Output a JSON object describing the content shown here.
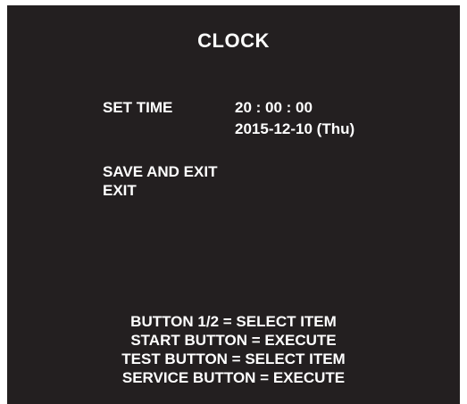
{
  "screen": {
    "title": "CLOCK",
    "set_time": {
      "label": "SET TIME",
      "time": "20 : 00 : 00",
      "date": "2015-12-10 (Thu)"
    },
    "menu": {
      "save_and_exit": "SAVE AND EXIT",
      "exit": "EXIT"
    },
    "help": [
      "BUTTON 1/2 = SELECT ITEM",
      "START BUTTON = EXECUTE",
      "TEST BUTTON = SELECT ITEM",
      "SERVICE BUTTON = EXECUTE"
    ]
  },
  "colors": {
    "background": "#231f20",
    "text": "#ffffff",
    "page": "#ffffff"
  }
}
